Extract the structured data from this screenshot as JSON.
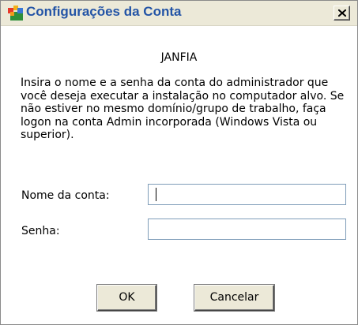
{
  "window": {
    "title": "Configurações da Conta",
    "icon": "app-icon"
  },
  "dialog": {
    "heading": "JANFIA",
    "description": "Insira o nome e a senha da conta do administrador que você deseja executar a instalação no computador alvo. Se não estiver no mesmo domínio/grupo de trabalho, faça logon na conta Admin incorporada (Windows Vista ou superior).",
    "fields": {
      "account_name_label": "Nome da conta:",
      "account_name_value": "",
      "password_label": "Senha:",
      "password_value": ""
    },
    "buttons": {
      "ok": "OK",
      "cancel": "Cancelar"
    }
  },
  "colors": {
    "title_text": "#2354a6",
    "titlebar_bg": "#ece9d8",
    "input_border": "#7f9db9",
    "button_bg": "#ece9d8"
  }
}
